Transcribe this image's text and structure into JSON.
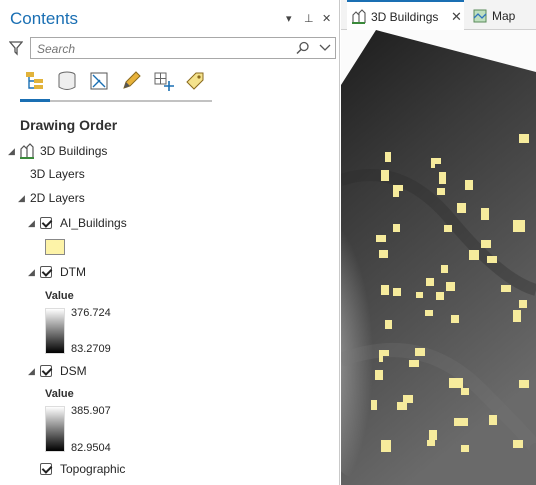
{
  "contents_pane": {
    "title": "Contents",
    "title_controls": {
      "menu": "▾",
      "pin": "⊥",
      "close": "✕"
    },
    "search": {
      "placeholder": "Search",
      "value": ""
    },
    "toolbar": [
      {
        "name": "list-by-drawing-order",
        "icon": "drawing-order-icon",
        "active": true
      },
      {
        "name": "list-by-data-source",
        "icon": "database-icon",
        "active": false
      },
      {
        "name": "list-by-selection",
        "icon": "selection-icon",
        "active": false
      },
      {
        "name": "list-by-editing",
        "icon": "pencil-icon",
        "active": false
      },
      {
        "name": "list-by-snapping",
        "icon": "snapping-icon",
        "active": false
      },
      {
        "name": "list-by-labeling",
        "icon": "label-tag-icon",
        "active": false
      }
    ],
    "heading": "Drawing Order",
    "tree": {
      "scene": "3D Buildings",
      "layers_3d": "3D Layers",
      "layers_2d": "2D Layers",
      "ai_buildings": {
        "label": "AI_Buildings",
        "checked": true,
        "symbol_color": "#fdf3a8"
      },
      "dtm": {
        "label": "DTM",
        "checked": true,
        "legend_title": "Value",
        "max": "376.724",
        "min": "83.2709"
      },
      "dsm": {
        "label": "DSM",
        "checked": true,
        "legend_title": "Value",
        "max": "385.907",
        "min": "82.9504"
      },
      "topographic": {
        "label": "Topographic",
        "checked": true
      }
    }
  },
  "view_tabs": [
    {
      "label": "3D Buildings",
      "active": true,
      "closable": true
    },
    {
      "label": "Map",
      "active": false,
      "closable": false
    }
  ],
  "colors": {
    "accent": "#1a6fb3",
    "building_fill": "#f6eb9c"
  }
}
